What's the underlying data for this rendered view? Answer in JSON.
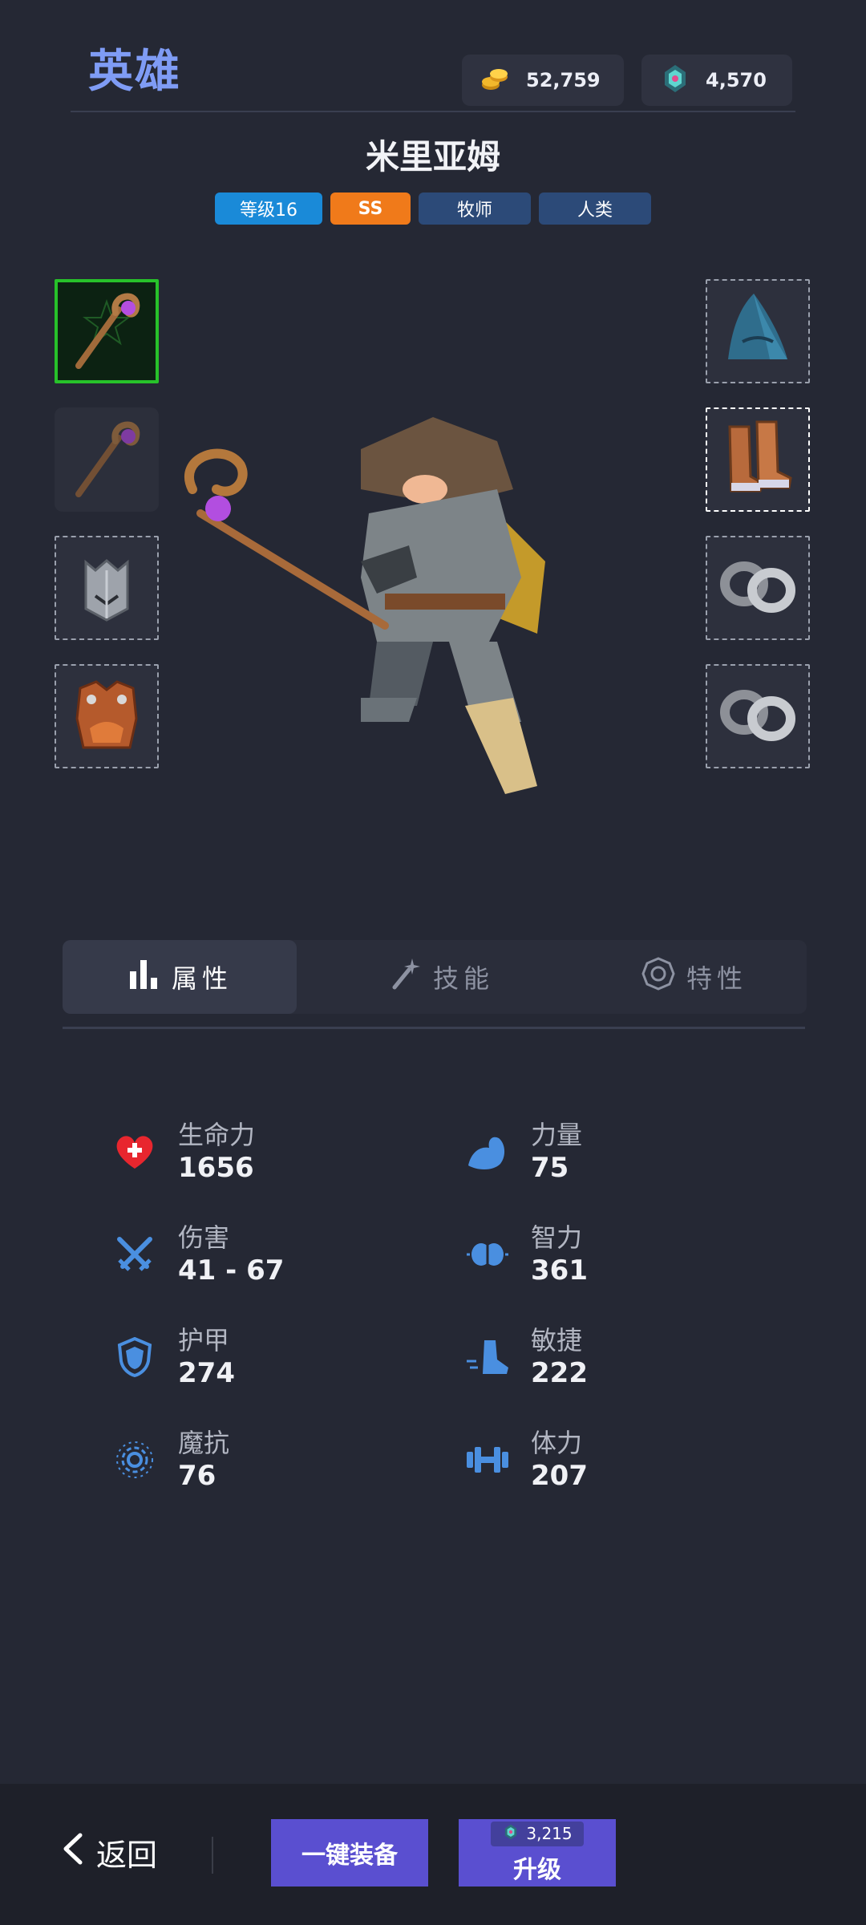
{
  "header": {
    "title": "英雄",
    "gold": "52,759",
    "gems": "4,570"
  },
  "hero": {
    "name": "米里亚姆",
    "tags": {
      "level": "等级16",
      "rank": "SS",
      "class": "牧师",
      "race": "人类"
    }
  },
  "equipment": {
    "left": [
      "staff-selected",
      "staff-empty-preview",
      "helmet",
      "chest-armor"
    ],
    "right": [
      "hood",
      "boots",
      "ring",
      "ring"
    ]
  },
  "tabs": [
    {
      "label": "属性",
      "icon": "bar-chart-icon",
      "active": true
    },
    {
      "label": "技能",
      "icon": "magic-wand-icon",
      "active": false
    },
    {
      "label": "特性",
      "icon": "trait-gear-icon",
      "active": false
    }
  ],
  "stats": {
    "left": [
      {
        "label": "生命力",
        "value": "1656",
        "icon": "heart-icon"
      },
      {
        "label": "伤害",
        "value": "41 - 67",
        "icon": "crossed-swords-icon"
      },
      {
        "label": "护甲",
        "value": "274",
        "icon": "shield-icon"
      },
      {
        "label": "魔抗",
        "value": "76",
        "icon": "magic-resist-icon"
      }
    ],
    "right": [
      {
        "label": "力量",
        "value": "75",
        "icon": "muscle-icon"
      },
      {
        "label": "智力",
        "value": "361",
        "icon": "brain-icon"
      },
      {
        "label": "敏捷",
        "value": "222",
        "icon": "boot-icon"
      },
      {
        "label": "体力",
        "value": "207",
        "icon": "dumbbell-icon"
      }
    ]
  },
  "footer": {
    "back_label": "返回",
    "equip_label": "一键装备",
    "upgrade_cost": "3,215",
    "upgrade_label": "升级"
  },
  "colors": {
    "background": "#252834",
    "accent_title": "#7f9cf5",
    "level_tag": "#1a8ad8",
    "rank_tag": "#f07a1a",
    "class_tag": "#2c4a78",
    "button_purple": "#5a4fd0",
    "selected_slot": "#27c22a",
    "stat_icon_blue": "#4a8fe0",
    "heart_red": "#e8262e"
  }
}
